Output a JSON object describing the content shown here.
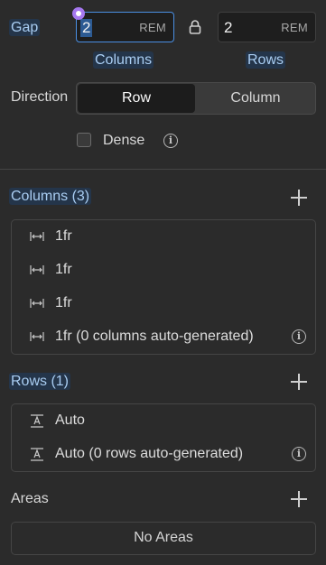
{
  "gap": {
    "label": "Gap",
    "columns": {
      "value": "2",
      "unit": "REM",
      "caption": "Columns"
    },
    "rows": {
      "value": "2",
      "unit": "REM",
      "caption": "Rows"
    }
  },
  "direction": {
    "label": "Direction",
    "options": [
      "Row",
      "Column"
    ],
    "selected": "Row"
  },
  "dense": {
    "label": "Dense",
    "checked": false
  },
  "columns_section": {
    "title": "Columns (3)",
    "items": [
      "1fr",
      "1fr",
      "1fr",
      "1fr (0 columns auto-generated)"
    ]
  },
  "rows_section": {
    "title": "Rows (1)",
    "items": [
      "Auto",
      "Auto (0 rows auto-generated)"
    ]
  },
  "areas_section": {
    "title": "Areas",
    "empty_text": "No Areas"
  },
  "icons": {
    "lock": "lock-icon",
    "info": "info-icon",
    "add": "plus-icon",
    "column_width": "arrows-horizontal-icon",
    "row_height": "text-height-icon"
  },
  "colors": {
    "background": "#2b2b2b",
    "accent": "#4a8fe3",
    "highlight_bg": "#24354a",
    "highlight_text": "#a9cdf2",
    "handle": "#a678f0"
  }
}
